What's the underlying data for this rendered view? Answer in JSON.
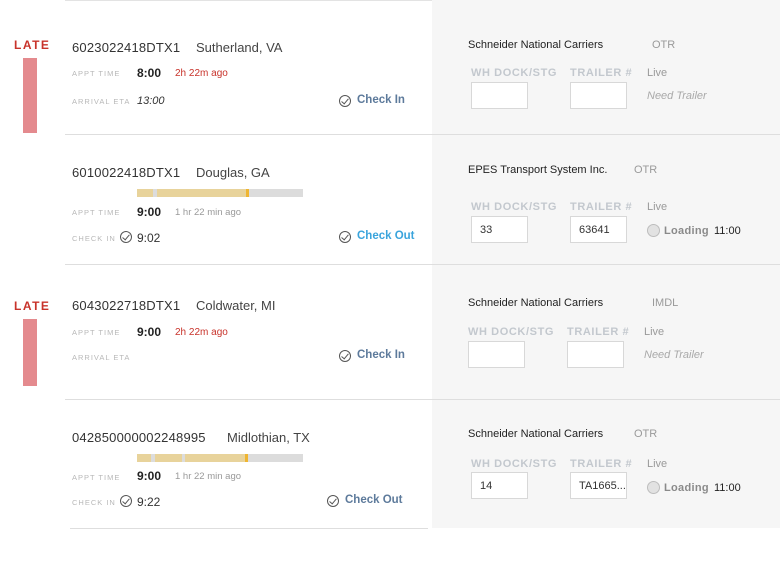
{
  "rows": [
    {
      "late_label": "LATE",
      "id": "6023022418DTX1",
      "location": "Sutherland, VA",
      "appt_label": "APPT TIME",
      "appt_time": "8:00",
      "late_note": "2h 22m ago",
      "second_label": "ARRIVAL ETA",
      "eta": "13:00",
      "action": "Check In",
      "carrier": "Schneider National Carriers",
      "mode": "OTR",
      "dock_label": "WH DOCK/STG",
      "trailer_label": "TRAILER #",
      "live_label": "Live",
      "dock_value": "",
      "trailer_value": "",
      "status": "Need Trailer"
    },
    {
      "id": "6010022418DTX1",
      "location": "Douglas, GA",
      "appt_label": "APPT TIME",
      "appt_time": "9:00",
      "elapsed": "1 hr 22 min ago",
      "second_label": "CHECK IN",
      "checkin_time": "9:02",
      "action": "Check Out",
      "carrier": "EPES Transport System Inc.",
      "mode": "OTR",
      "dock_label": "WH DOCK/STG",
      "trailer_label": "TRAILER #",
      "live_label": "Live",
      "dock_value": "33",
      "trailer_value": "63641",
      "status": "Loading",
      "status_time": "11:00",
      "progress": 0.66
    },
    {
      "late_label": "LATE",
      "id": "6043022718DTX1",
      "location": "Coldwater, MI",
      "appt_label": "APPT TIME",
      "appt_time": "9:00",
      "late_note": "2h 22m ago",
      "second_label": "ARRIVAL ETA",
      "eta": "",
      "action": "Check In",
      "carrier": "Schneider National Carriers",
      "mode": "IMDL",
      "dock_label": "WH DOCK/STG",
      "trailer_label": "TRAILER #",
      "live_label": "Live",
      "dock_value": "",
      "trailer_value": "",
      "status": "Need Trailer"
    },
    {
      "id": "042850000002248995",
      "location": "Midlothian, TX",
      "appt_label": "APPT TIME",
      "appt_time": "9:00",
      "elapsed": "1 hr 22 min ago",
      "second_label": "CHECK IN",
      "checkin_time": "9:22",
      "action": "Check Out",
      "carrier": "Schneider National Carriers",
      "mode": "OTR",
      "dock_label": "WH DOCK/STG",
      "trailer_label": "TRAILER #",
      "live_label": "Live",
      "dock_value": "14",
      "trailer_value": "TA1665...",
      "status": "Loading",
      "status_time": "11:00",
      "progress": 0.65
    }
  ],
  "colors": {
    "late": "#c8332b",
    "late_bar": "#e48a8e",
    "check_in": "#5d7a9b",
    "check_out": "#3aa4dc",
    "progress_fill": "#e8d39b",
    "progress_marker": "#efb531",
    "panel_bg": "#f6f6f6"
  },
  "icons": {
    "action": "check-circle-icon",
    "checked_in": "check-circle-icon",
    "loading": "status-dot-icon"
  }
}
